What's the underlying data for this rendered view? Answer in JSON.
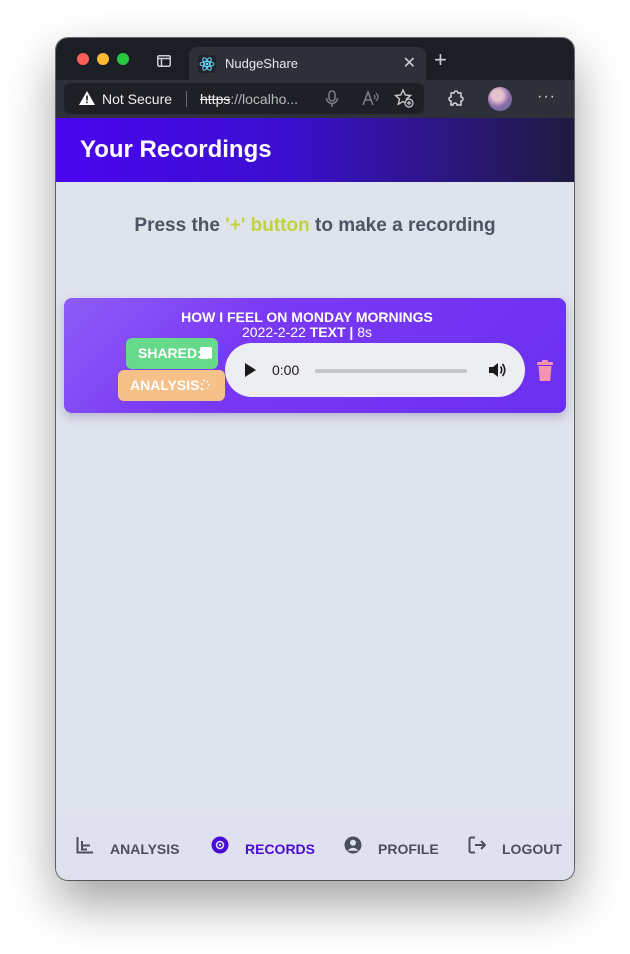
{
  "browser": {
    "tab_title": "NudgeShare",
    "security_label": "Not Secure",
    "url_scheme": "https",
    "url_rest": "://localho..."
  },
  "app": {
    "title": "Your Recordings",
    "hint_prefix": "Press the ",
    "hint_accent": "'+' button",
    "hint_suffix": " to make a recording",
    "accent_color": "#c1d43d"
  },
  "recordings": [
    {
      "title": "HOW I FEEL ON MONDAY MORNINGS",
      "date": "2022-2-22",
      "type": "TEXT",
      "separator": "|",
      "duration": "8s",
      "shared_label": "SHARED:",
      "analysis_label": "ANALYSIS:",
      "player_time": "0:00"
    }
  ],
  "nav": {
    "analysis": "ANALYSIS",
    "records": "RECORDS",
    "profile": "PROFILE",
    "logout": "LOGOUT"
  },
  "colors": {
    "header_gradient_start": "#4a06f0",
    "card": "#7a3af4",
    "shared_badge": "#67d98a",
    "analysis_badge": "#f6c089",
    "fab": "#ccd94f",
    "nav_active": "#4b0bd6"
  },
  "icons": [
    "react-favicon-icon",
    "warning-icon",
    "microphone-icon",
    "read-aloud-icon",
    "favorites-icon",
    "extensions-icon",
    "play-icon",
    "volume-icon",
    "trash-icon",
    "plus-icon",
    "chart-icon",
    "disc-icon",
    "user-circle-icon",
    "logout-icon"
  ]
}
